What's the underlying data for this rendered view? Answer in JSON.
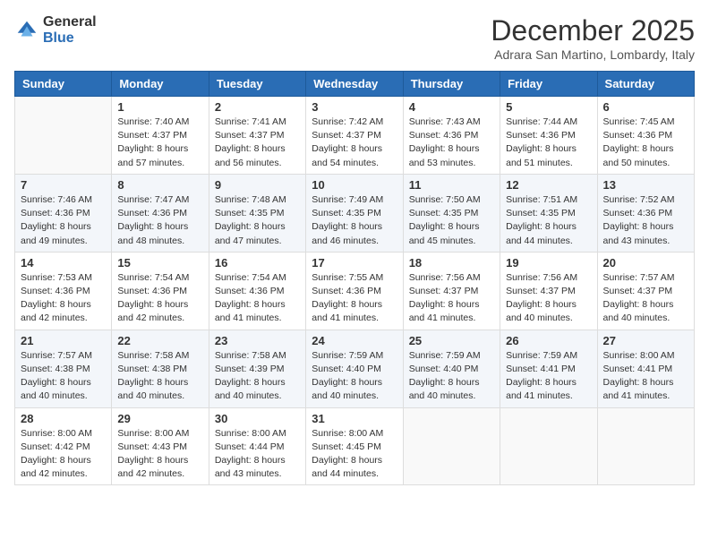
{
  "logo": {
    "general": "General",
    "blue": "Blue"
  },
  "header": {
    "month": "December 2025",
    "location": "Adrara San Martino, Lombardy, Italy"
  },
  "weekdays": [
    "Sunday",
    "Monday",
    "Tuesday",
    "Wednesday",
    "Thursday",
    "Friday",
    "Saturday"
  ],
  "weeks": [
    [
      {
        "day": "",
        "sunrise": "",
        "sunset": "",
        "daylight": ""
      },
      {
        "day": "1",
        "sunrise": "Sunrise: 7:40 AM",
        "sunset": "Sunset: 4:37 PM",
        "daylight": "Daylight: 8 hours and 57 minutes."
      },
      {
        "day": "2",
        "sunrise": "Sunrise: 7:41 AM",
        "sunset": "Sunset: 4:37 PM",
        "daylight": "Daylight: 8 hours and 56 minutes."
      },
      {
        "day": "3",
        "sunrise": "Sunrise: 7:42 AM",
        "sunset": "Sunset: 4:37 PM",
        "daylight": "Daylight: 8 hours and 54 minutes."
      },
      {
        "day": "4",
        "sunrise": "Sunrise: 7:43 AM",
        "sunset": "Sunset: 4:36 PM",
        "daylight": "Daylight: 8 hours and 53 minutes."
      },
      {
        "day": "5",
        "sunrise": "Sunrise: 7:44 AM",
        "sunset": "Sunset: 4:36 PM",
        "daylight": "Daylight: 8 hours and 51 minutes."
      },
      {
        "day": "6",
        "sunrise": "Sunrise: 7:45 AM",
        "sunset": "Sunset: 4:36 PM",
        "daylight": "Daylight: 8 hours and 50 minutes."
      }
    ],
    [
      {
        "day": "7",
        "sunrise": "Sunrise: 7:46 AM",
        "sunset": "Sunset: 4:36 PM",
        "daylight": "Daylight: 8 hours and 49 minutes."
      },
      {
        "day": "8",
        "sunrise": "Sunrise: 7:47 AM",
        "sunset": "Sunset: 4:36 PM",
        "daylight": "Daylight: 8 hours and 48 minutes."
      },
      {
        "day": "9",
        "sunrise": "Sunrise: 7:48 AM",
        "sunset": "Sunset: 4:35 PM",
        "daylight": "Daylight: 8 hours and 47 minutes."
      },
      {
        "day": "10",
        "sunrise": "Sunrise: 7:49 AM",
        "sunset": "Sunset: 4:35 PM",
        "daylight": "Daylight: 8 hours and 46 minutes."
      },
      {
        "day": "11",
        "sunrise": "Sunrise: 7:50 AM",
        "sunset": "Sunset: 4:35 PM",
        "daylight": "Daylight: 8 hours and 45 minutes."
      },
      {
        "day": "12",
        "sunrise": "Sunrise: 7:51 AM",
        "sunset": "Sunset: 4:35 PM",
        "daylight": "Daylight: 8 hours and 44 minutes."
      },
      {
        "day": "13",
        "sunrise": "Sunrise: 7:52 AM",
        "sunset": "Sunset: 4:36 PM",
        "daylight": "Daylight: 8 hours and 43 minutes."
      }
    ],
    [
      {
        "day": "14",
        "sunrise": "Sunrise: 7:53 AM",
        "sunset": "Sunset: 4:36 PM",
        "daylight": "Daylight: 8 hours and 42 minutes."
      },
      {
        "day": "15",
        "sunrise": "Sunrise: 7:54 AM",
        "sunset": "Sunset: 4:36 PM",
        "daylight": "Daylight: 8 hours and 42 minutes."
      },
      {
        "day": "16",
        "sunrise": "Sunrise: 7:54 AM",
        "sunset": "Sunset: 4:36 PM",
        "daylight": "Daylight: 8 hours and 41 minutes."
      },
      {
        "day": "17",
        "sunrise": "Sunrise: 7:55 AM",
        "sunset": "Sunset: 4:36 PM",
        "daylight": "Daylight: 8 hours and 41 minutes."
      },
      {
        "day": "18",
        "sunrise": "Sunrise: 7:56 AM",
        "sunset": "Sunset: 4:37 PM",
        "daylight": "Daylight: 8 hours and 41 minutes."
      },
      {
        "day": "19",
        "sunrise": "Sunrise: 7:56 AM",
        "sunset": "Sunset: 4:37 PM",
        "daylight": "Daylight: 8 hours and 40 minutes."
      },
      {
        "day": "20",
        "sunrise": "Sunrise: 7:57 AM",
        "sunset": "Sunset: 4:37 PM",
        "daylight": "Daylight: 8 hours and 40 minutes."
      }
    ],
    [
      {
        "day": "21",
        "sunrise": "Sunrise: 7:57 AM",
        "sunset": "Sunset: 4:38 PM",
        "daylight": "Daylight: 8 hours and 40 minutes."
      },
      {
        "day": "22",
        "sunrise": "Sunrise: 7:58 AM",
        "sunset": "Sunset: 4:38 PM",
        "daylight": "Daylight: 8 hours and 40 minutes."
      },
      {
        "day": "23",
        "sunrise": "Sunrise: 7:58 AM",
        "sunset": "Sunset: 4:39 PM",
        "daylight": "Daylight: 8 hours and 40 minutes."
      },
      {
        "day": "24",
        "sunrise": "Sunrise: 7:59 AM",
        "sunset": "Sunset: 4:40 PM",
        "daylight": "Daylight: 8 hours and 40 minutes."
      },
      {
        "day": "25",
        "sunrise": "Sunrise: 7:59 AM",
        "sunset": "Sunset: 4:40 PM",
        "daylight": "Daylight: 8 hours and 40 minutes."
      },
      {
        "day": "26",
        "sunrise": "Sunrise: 7:59 AM",
        "sunset": "Sunset: 4:41 PM",
        "daylight": "Daylight: 8 hours and 41 minutes."
      },
      {
        "day": "27",
        "sunrise": "Sunrise: 8:00 AM",
        "sunset": "Sunset: 4:41 PM",
        "daylight": "Daylight: 8 hours and 41 minutes."
      }
    ],
    [
      {
        "day": "28",
        "sunrise": "Sunrise: 8:00 AM",
        "sunset": "Sunset: 4:42 PM",
        "daylight": "Daylight: 8 hours and 42 minutes."
      },
      {
        "day": "29",
        "sunrise": "Sunrise: 8:00 AM",
        "sunset": "Sunset: 4:43 PM",
        "daylight": "Daylight: 8 hours and 42 minutes."
      },
      {
        "day": "30",
        "sunrise": "Sunrise: 8:00 AM",
        "sunset": "Sunset: 4:44 PM",
        "daylight": "Daylight: 8 hours and 43 minutes."
      },
      {
        "day": "31",
        "sunrise": "Sunrise: 8:00 AM",
        "sunset": "Sunset: 4:45 PM",
        "daylight": "Daylight: 8 hours and 44 minutes."
      },
      {
        "day": "",
        "sunrise": "",
        "sunset": "",
        "daylight": ""
      },
      {
        "day": "",
        "sunrise": "",
        "sunset": "",
        "daylight": ""
      },
      {
        "day": "",
        "sunrise": "",
        "sunset": "",
        "daylight": ""
      }
    ]
  ]
}
